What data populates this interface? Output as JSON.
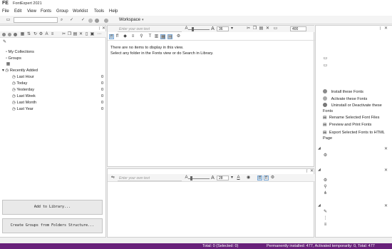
{
  "app": {
    "logo": "FE",
    "title": "FontExpert 2021"
  },
  "menu": [
    "File",
    "Edit",
    "View",
    "Fonts",
    "Group",
    "Worklist",
    "Tools",
    "Help"
  ],
  "toolbar": {
    "workspace_label": "Workspace",
    "workspace_caret": "▾"
  },
  "left_panel": {
    "tree": [
      {
        "label": "My Collections"
      },
      {
        "label": "Groups"
      },
      {
        "label": "Recently Added"
      }
    ],
    "recent": [
      {
        "label": "Last Hour",
        "count": "0"
      },
      {
        "label": "Today",
        "count": "0"
      },
      {
        "label": "Yesterday",
        "count": "0"
      },
      {
        "label": "Last Week",
        "count": "0"
      },
      {
        "label": "Last Month",
        "count": "0"
      },
      {
        "label": "Last Year",
        "count": "0"
      }
    ],
    "add_library_label": "Add to Library...",
    "create_groups_label": "Create Groups from Folders Structure..."
  },
  "view_panel": {
    "placeholder": "Enter your own text",
    "size": "36",
    "zoom": "400",
    "message_line1": "There are no items to display in this view.",
    "message_line2": "Select any folder in the Fonts view or do Search in Library."
  },
  "preview_panel": {
    "placeholder": "Enter your own text",
    "size": "28"
  },
  "actions": [
    {
      "label": "Install these Fonts"
    },
    {
      "label": "Activate these Fonts"
    },
    {
      "label": "Uninstall or Deactivate these Fonts"
    },
    {
      "label": "Rename Selected Font Files"
    },
    {
      "label": "Preview and Print Fonts"
    },
    {
      "label": "Export Selected Fonts to HTML Page"
    }
  ],
  "status": {
    "total": "Total: 0 (Selected: 0)",
    "summary": "Permanently installed: 477, Activated temporarily: 0, Total: 477"
  },
  "colors": {
    "status_bar": "#68217a",
    "accent_dot": "#8a8a8a"
  }
}
